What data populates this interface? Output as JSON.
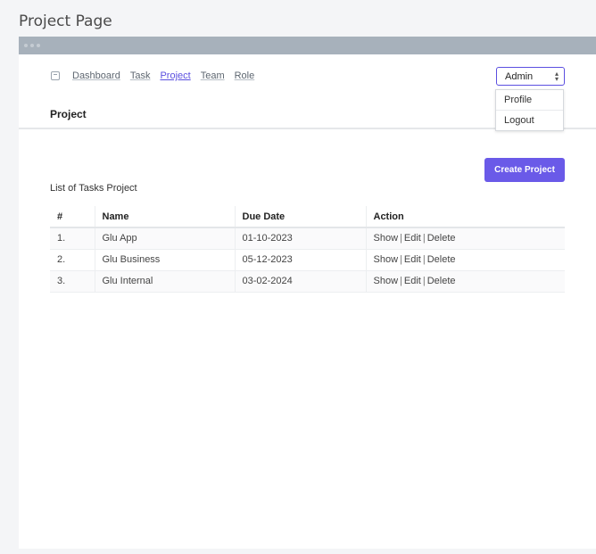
{
  "page": {
    "title": "Project Page"
  },
  "nav": {
    "items": [
      {
        "label": "Dashboard",
        "active": false
      },
      {
        "label": "Task",
        "active": false
      },
      {
        "label": "Project",
        "active": true
      },
      {
        "label": "Team",
        "active": false
      },
      {
        "label": "Role",
        "active": false
      }
    ]
  },
  "header": {
    "section_title": "Project"
  },
  "user_menu": {
    "selected": "Admin",
    "options": [
      "Profile",
      "Logout"
    ]
  },
  "actions": {
    "create_label": "Create Project"
  },
  "list": {
    "title": "List of Tasks Project",
    "columns": [
      "#",
      "Name",
      "Due Date",
      "Action"
    ],
    "rows": [
      {
        "no": "1.",
        "name": "Glu App",
        "due": "01-10-2023"
      },
      {
        "no": "2.",
        "name": "Glu Business",
        "due": "05-12-2023"
      },
      {
        "no": "3.",
        "name": "Glu Internal",
        "due": "03-02-2024"
      }
    ],
    "row_actions": {
      "show": "Show",
      "edit": "Edit",
      "delete": "Delete",
      "separator": "|"
    }
  },
  "colors": {
    "accent": "#6a5ae8",
    "active_link": "#5b4fe0",
    "titlebar": "#a7b1bb"
  }
}
